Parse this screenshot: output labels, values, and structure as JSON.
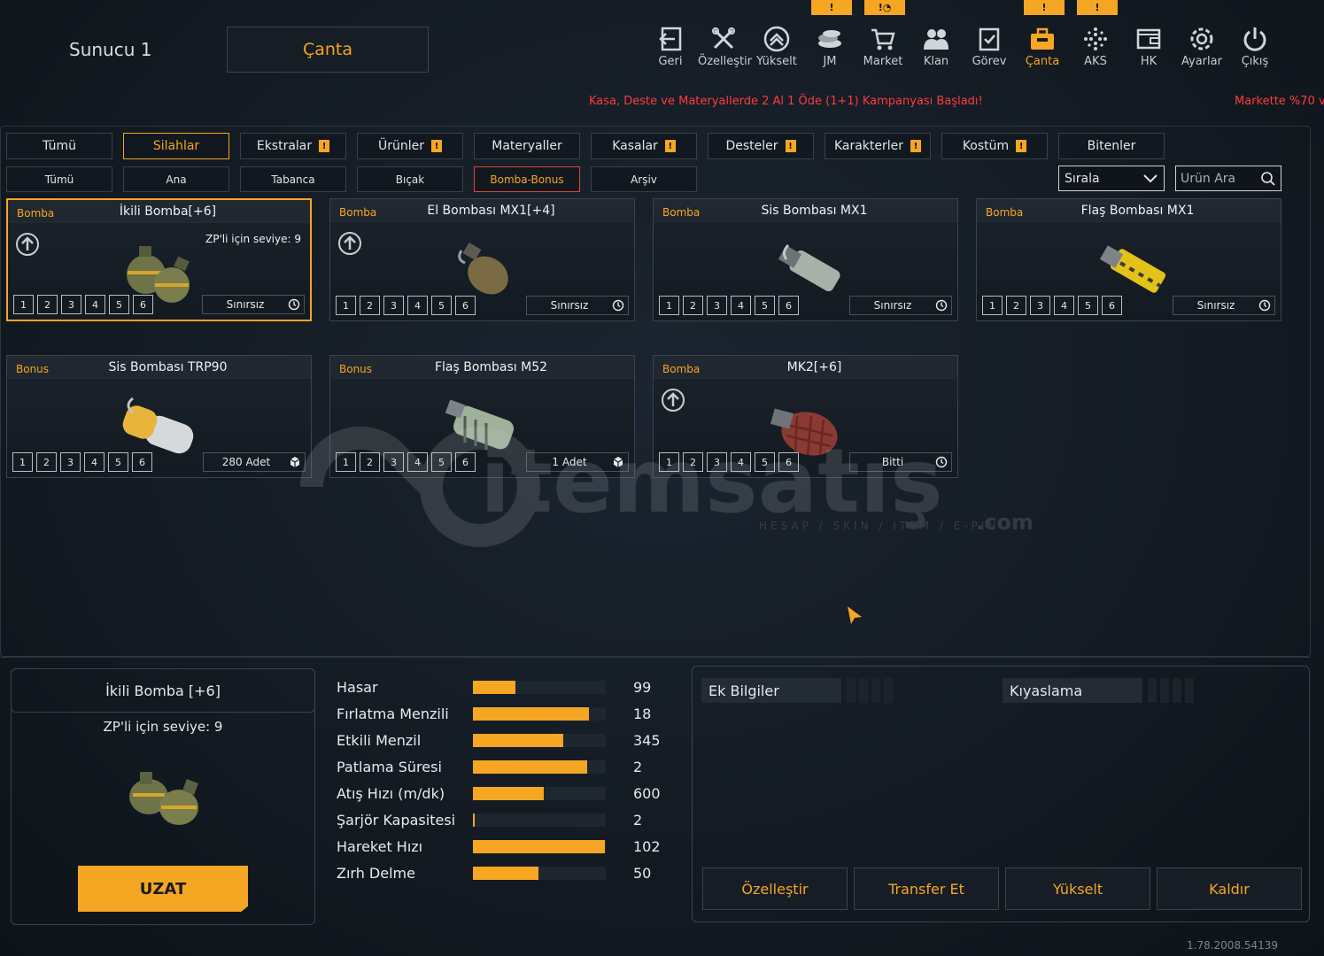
{
  "header": {
    "server": "Sunucu 1",
    "page_tab": "Çanta",
    "nav": [
      {
        "label": "Geri",
        "icon": "back-icon"
      },
      {
        "label": "Özelleştir",
        "icon": "tools-icon"
      },
      {
        "label": "Yükselt",
        "icon": "upgrade-icon"
      },
      {
        "label": "JM",
        "icon": "coins-icon",
        "badge": "!"
      },
      {
        "label": "Market",
        "icon": "cart-icon",
        "badge": "!◔"
      },
      {
        "label": "Klan",
        "icon": "clan-icon"
      },
      {
        "label": "Görev",
        "icon": "mission-icon"
      },
      {
        "label": "Çanta",
        "icon": "bag-icon",
        "badge": "!"
      },
      {
        "label": "AKS",
        "icon": "aks-icon",
        "badge": "!"
      },
      {
        "label": "HK",
        "icon": "wallet-icon"
      },
      {
        "label": "Ayarlar",
        "icon": "gear-icon"
      },
      {
        "label": "Çıkış",
        "icon": "power-icon"
      }
    ],
    "ticker": "Kasa, Deste ve Materyallerde 2 Al 1 Öde (1+1) Kampanyası Başladı!",
    "ticker2": "Markette %70 v"
  },
  "categories": [
    "Tümü",
    "Silahlar",
    "Ekstralar",
    "Ürünler",
    "Materyaller",
    "Kasalar",
    "Desteler",
    "Karakterler",
    "Kostüm",
    "Bitenler"
  ],
  "category_warn": [
    false,
    false,
    true,
    true,
    false,
    true,
    true,
    true,
    true,
    false
  ],
  "active_category": "Silahlar",
  "subcategories": [
    "Tümü",
    "Ana",
    "Tabanca",
    "Bıçak",
    "Bomba-Bonus",
    "Arşiv"
  ],
  "active_subcategory": "Bomba-Bonus",
  "sort": {
    "label": "Sırala"
  },
  "search": {
    "placeholder": "Ürün Ara"
  },
  "items": [
    {
      "type": "Bomba",
      "name": "İkili Bomba[+6]",
      "req": "ZP'li için seviye: 9",
      "duration": "Sınırsız",
      "upgrade": true,
      "selected": true
    },
    {
      "type": "Bomba",
      "name": "El Bombası MX1[+4]",
      "duration": "Sınırsız",
      "upgrade": true
    },
    {
      "type": "Bomba",
      "name": "Sis Bombası MX1",
      "duration": "Sınırsız"
    },
    {
      "type": "Bomba",
      "name": "Flaş Bombası MX1",
      "duration": "Sınırsız"
    },
    {
      "type": "Bonus",
      "name": "Sis Bombası TRP90",
      "duration": "280 Adet"
    },
    {
      "type": "Bonus",
      "name": "Flaş Bombası M52",
      "duration": "1 Adet"
    },
    {
      "type": "Bomba",
      "name": "MK2[+6]",
      "duration": "Bitti",
      "upgrade": true
    }
  ],
  "slots": [
    "1",
    "2",
    "3",
    "4",
    "5",
    "6"
  ],
  "watermark": {
    "brand": "itemsatış",
    "suffix": ".com",
    "tagline": "HESAP / SKIN / ITEM / E-PIN"
  },
  "detail": {
    "title": "İkili Bomba [+6]",
    "req": "ZP'li için seviye: 9",
    "extend_label": "UZAT",
    "stats": [
      {
        "label": "Hasar",
        "value": "99",
        "fill": 0.32
      },
      {
        "label": "Fırlatma Menzili",
        "value": "18",
        "fill": 0.87
      },
      {
        "label": "Etkili Menzil",
        "value": "345",
        "fill": 0.68
      },
      {
        "label": "Patlama Süresi",
        "value": "2",
        "fill": 0.86
      },
      {
        "label": "Atış Hızı (m/dk)",
        "value": "600",
        "fill": 0.53
      },
      {
        "label": "Şarjör Kapasitesi",
        "value": "2",
        "fill": 0.01
      },
      {
        "label": "Hareket Hızı",
        "value": "102",
        "fill": 0.99
      },
      {
        "label": "Zırh Delme",
        "value": "50",
        "fill": 0.49
      }
    ]
  },
  "info": {
    "extra_label": "Ek Bilgiler",
    "compare_label": "Kıyaslama",
    "actions": [
      "Özelleştir",
      "Transfer Et",
      "Yükselt",
      "Kaldır"
    ]
  },
  "version": "1.78.2008.54139",
  "colors": {
    "accent": "#f5a623",
    "ticker": "#ff3b3b",
    "active_sub_border": "#e0453a"
  }
}
